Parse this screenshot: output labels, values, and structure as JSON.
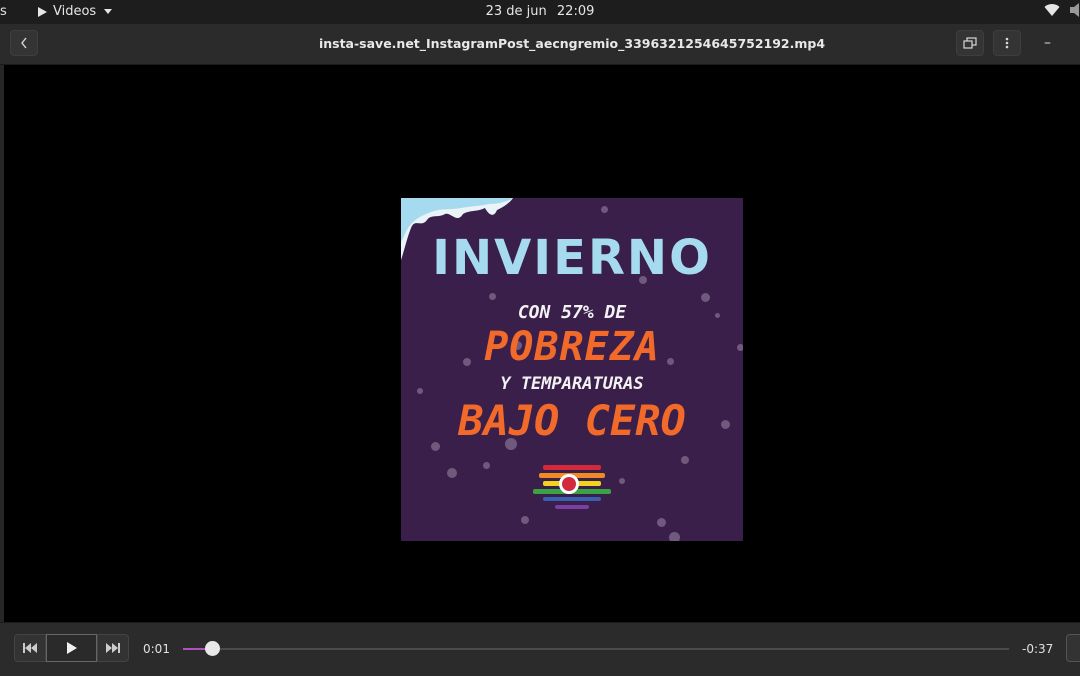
{
  "topbar": {
    "activities_label": "s",
    "app_menu_label": "Videos",
    "date": "23 de jun",
    "time": "22:09"
  },
  "titlebar": {
    "title": "insta-save.net_InstagramPost_aecngremio_3396321254645752192.mp4",
    "back_icon": "chevron-left-icon",
    "popout_icon": "picture-in-picture-icon",
    "menu_icon": "vertical-ellipsis-icon",
    "minimize_label": "–"
  },
  "poster": {
    "title": "INVIERNO",
    "line1": "CON 57% DE",
    "line2": "POBREZA",
    "line3": "Y TEMPARATURAS",
    "line4": "BAJO CERO",
    "colors": {
      "background": "#3a1f4b",
      "title": "#a6dbef",
      "accent": "#f26a2a"
    }
  },
  "controls": {
    "current_time": "0:01",
    "remaining_time": "-0:37",
    "progress_fraction": 0.035,
    "accent_color": "#b04fc0"
  }
}
